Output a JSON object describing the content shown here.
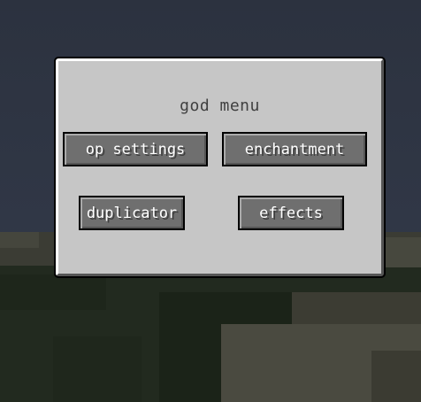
{
  "menu": {
    "title": "god menu",
    "buttons": [
      {
        "label": "op settings"
      },
      {
        "label": "enchantment"
      },
      {
        "label": "duplicator"
      },
      {
        "label": "effects"
      }
    ]
  },
  "colors": {
    "panel": "#c6c6c6",
    "button": "#6f6f6f",
    "button_text": "#ffffff",
    "title_text": "#404040",
    "sky": "#303746",
    "grass_dark": "#222a1f",
    "dirt": "#4a4a40"
  }
}
